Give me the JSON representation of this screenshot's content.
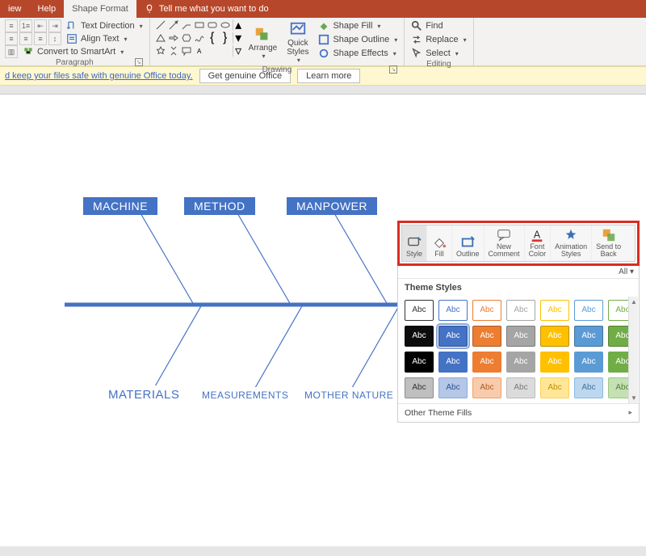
{
  "tabs": {
    "view": "iew",
    "help": "Help",
    "shape_format": "Shape Format",
    "tell_me": "Tell me what you want to do"
  },
  "ribbon": {
    "paragraph": {
      "label": "Paragraph",
      "text_direction": "Text Direction",
      "align_text": "Align Text",
      "convert_smartart": "Convert to SmartArt"
    },
    "drawing": {
      "label": "Drawing",
      "arrange": "Arrange",
      "quick_styles": "Quick\nStyles",
      "shape_fill": "Shape Fill",
      "shape_outline": "Shape Outline",
      "shape_effects": "Shape Effects"
    },
    "editing": {
      "label": "Editing",
      "find": "Find",
      "replace": "Replace",
      "select": "Select"
    }
  },
  "msgbar": {
    "text": "d keep your files safe with genuine Office today.",
    "btn1": "Get genuine Office",
    "btn2": "Learn more"
  },
  "diagram": {
    "top": [
      "MACHINE",
      "METHOD",
      "MANPOWER"
    ],
    "bottom": [
      "MATERIALS",
      "MEASUREMENTS",
      "MOTHER NATURE"
    ]
  },
  "mini_toolbar": {
    "items": [
      {
        "id": "style",
        "label": "Style"
      },
      {
        "id": "fill",
        "label": "Fill"
      },
      {
        "id": "outline",
        "label": "Outline"
      },
      {
        "id": "new_comment",
        "label": "New\nComment"
      },
      {
        "id": "font_color",
        "label": "Font\nColor"
      },
      {
        "id": "anim_styles",
        "label": "Animation\nStyles"
      },
      {
        "id": "send_back",
        "label": "Send to\nBack"
      }
    ],
    "active": "style"
  },
  "style_pane": {
    "all": "All",
    "header": "Theme Styles",
    "swatch_label": "Abc",
    "footer": "Other Theme Fills",
    "rows": [
      [
        {
          "bg": "#ffffff",
          "fg": "#333333",
          "border": "#333333"
        },
        {
          "bg": "#ffffff",
          "fg": "#4472c4",
          "border": "#4472c4"
        },
        {
          "bg": "#ffffff",
          "fg": "#ed7d31",
          "border": "#ed7d31"
        },
        {
          "bg": "#ffffff",
          "fg": "#a5a5a5",
          "border": "#a5a5a5"
        },
        {
          "bg": "#ffffff",
          "fg": "#ffc000",
          "border": "#ffc000"
        },
        {
          "bg": "#ffffff",
          "fg": "#5b9bd5",
          "border": "#5b9bd5"
        },
        {
          "bg": "#ffffff",
          "fg": "#70ad47",
          "border": "#70ad47"
        }
      ],
      [
        {
          "bg": "#0d0d0d",
          "fg": "#ffffff",
          "border": "#0d0d0d"
        },
        {
          "bg": "#4472c4",
          "fg": "#ffffff",
          "border": "#2f528f",
          "selected": true
        },
        {
          "bg": "#ed7d31",
          "fg": "#ffffff",
          "border": "#ae5a21"
        },
        {
          "bg": "#a5a5a5",
          "fg": "#ffffff",
          "border": "#787878"
        },
        {
          "bg": "#ffc000",
          "fg": "#ffffff",
          "border": "#bf9000"
        },
        {
          "bg": "#5b9bd5",
          "fg": "#ffffff",
          "border": "#41729f"
        },
        {
          "bg": "#70ad47",
          "fg": "#ffffff",
          "border": "#548235"
        }
      ],
      [
        {
          "bg": "#000000",
          "fg": "#ffffff",
          "border": "#000000"
        },
        {
          "bg": "#4472c4",
          "fg": "#ffffff",
          "border": "#4472c4"
        },
        {
          "bg": "#ed7d31",
          "fg": "#ffffff",
          "border": "#ed7d31"
        },
        {
          "bg": "#a5a5a5",
          "fg": "#ffffff",
          "border": "#a5a5a5"
        },
        {
          "bg": "#ffc000",
          "fg": "#ffffff",
          "border": "#ffc000"
        },
        {
          "bg": "#5b9bd5",
          "fg": "#ffffff",
          "border": "#5b9bd5"
        },
        {
          "bg": "#70ad47",
          "fg": "#ffffff",
          "border": "#70ad47"
        }
      ],
      [
        {
          "bg": "#bfbfbf",
          "fg": "#333333",
          "border": "#8c8c8c"
        },
        {
          "bg": "#b4c7e7",
          "fg": "#2f528f",
          "border": "#8faad9"
        },
        {
          "bg": "#f8cbad",
          "fg": "#ae5a21",
          "border": "#f1a06b"
        },
        {
          "bg": "#dbdbdb",
          "fg": "#787878",
          "border": "#bcbcbc"
        },
        {
          "bg": "#ffe699",
          "fg": "#bf9000",
          "border": "#ffd24d"
        },
        {
          "bg": "#bdd7ee",
          "fg": "#41729f",
          "border": "#8bb9e0"
        },
        {
          "bg": "#c5e0b4",
          "fg": "#548235",
          "border": "#9cc97e"
        }
      ]
    ]
  }
}
